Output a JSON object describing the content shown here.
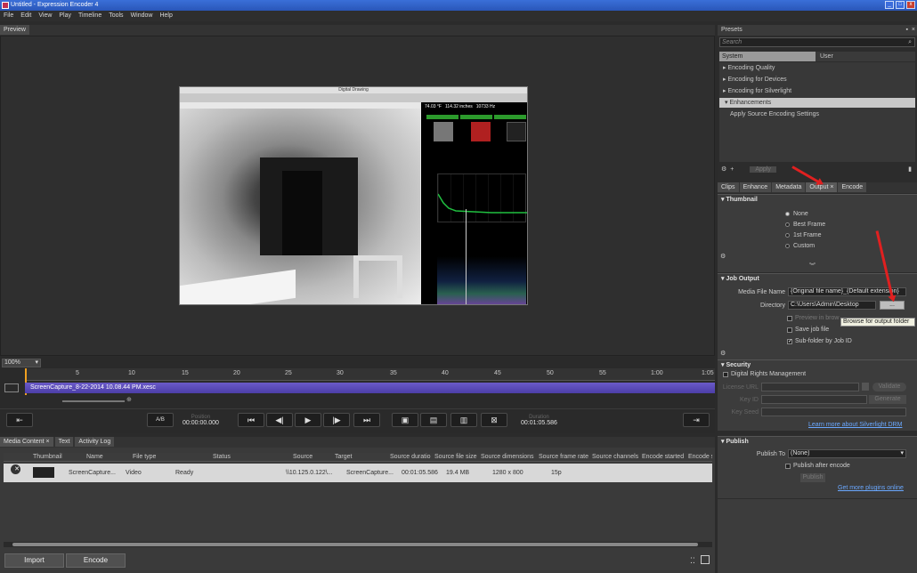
{
  "window": {
    "title": "Untitled - Expression Encoder 4"
  },
  "menu": [
    "File",
    "Edit",
    "View",
    "Play",
    "Timeline",
    "Tools",
    "Window",
    "Help"
  ],
  "preview": {
    "tab": "Preview",
    "video_title": "Digital Drawing",
    "hud": [
      "74.03 °F",
      "114.32 inches",
      "10733 Hz"
    ]
  },
  "timeline": {
    "zoom": "100%",
    "ticks": [
      "5",
      "10",
      "15",
      "20",
      "25",
      "30",
      "35",
      "40",
      "45",
      "50",
      "55",
      "1:00",
      "1:05"
    ],
    "clip_name": "ScreenCapture_8-22-2014 10.08.44 PM.xesc"
  },
  "transport": {
    "ab_label": "A/B",
    "position_label": "Position",
    "position": "00:00:00.000",
    "duration_label": "Duration",
    "duration": "00:01:05.586"
  },
  "media": {
    "tabs": [
      "Media Content",
      "Text",
      "Activity Log"
    ],
    "columns": [
      "Thumbnail",
      "Name",
      "File type",
      "Status",
      "Source",
      "Target",
      "Source duratio",
      "Source file size",
      "Source dimensions",
      "Source frame rate",
      "Source channels",
      "Encode started",
      "Encode s"
    ],
    "rows": [
      {
        "name": "ScreenCapture...",
        "file_type": "Video",
        "status": "Ready",
        "source": "\\\\10.125.0.122\\...",
        "target": "ScreenCapture...",
        "duration": "00:01:05.586",
        "size": "19.4 MB",
        "dimensions": "1280 x 800",
        "frame_rate": "15p"
      }
    ],
    "import_label": "Import",
    "encode_label": "Encode"
  },
  "presets": {
    "title": "Presets",
    "search_placeholder": "Search",
    "tabs": [
      "System",
      "User"
    ],
    "items": [
      "Encoding Quality",
      "Encoding for Devices",
      "Encoding for Silverlight",
      "Enhancements",
      "Apply Source Encoding Settings"
    ],
    "apply_label": "Apply"
  },
  "props_tabs": [
    "Clips",
    "Enhance",
    "Metadata",
    "Output",
    "Encode"
  ],
  "thumbnail": {
    "title": "Thumbnail",
    "options": [
      "None",
      "Best Frame",
      "1st Frame",
      "Custom"
    ]
  },
  "job_output": {
    "title": "Job Output",
    "media_file_label": "Media File Name",
    "media_file_value": "{Original file name}_{Default extension}",
    "directory_label": "Directory",
    "directory_value": "C:\\Users\\Admin\\Desktop",
    "browse_label": "...",
    "tooltip": "Browse for output folder",
    "preview_label": "Preview in brow",
    "save_job_label": "Save job file",
    "subfolder_label": "Sub-folder by Job ID"
  },
  "security": {
    "title": "Security",
    "drm_label": "Digital Rights Management",
    "license_label": "License URL",
    "keyid_label": "Key ID",
    "keyseed_label": "Key Seed",
    "validate_label": "Validate",
    "generate_label": "Generate",
    "learn_link": "Learn more about Silverlight DRM"
  },
  "publish": {
    "title": "Publish",
    "publish_to_label": "Publish To",
    "publish_to_value": "(None)",
    "after_encode_label": "Publish after encode",
    "publish_btn": "Publish",
    "plugins_link": "Get more plugins online"
  }
}
